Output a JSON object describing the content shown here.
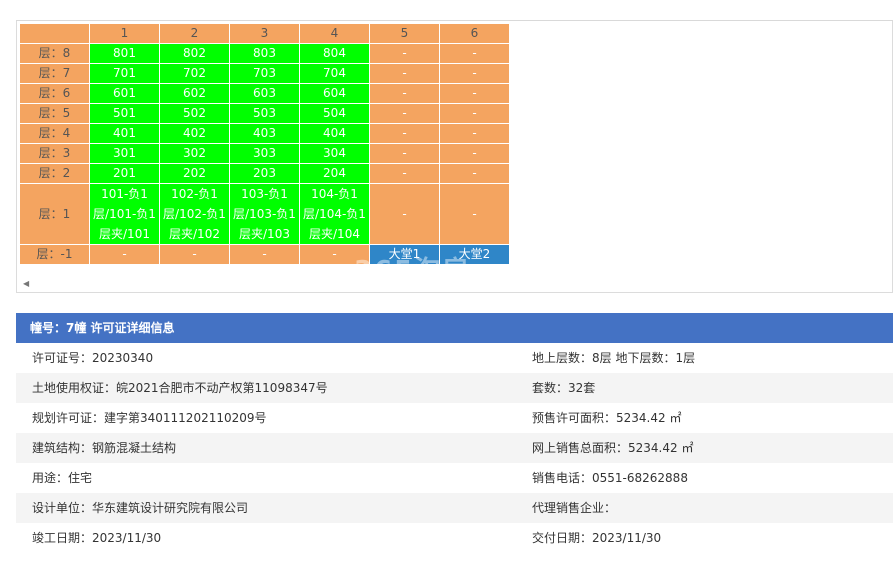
{
  "unit_grid": {
    "columns": [
      "1",
      "2",
      "3",
      "4",
      "5",
      "6"
    ],
    "rows": [
      {
        "floor": "层：8",
        "cells": [
          {
            "text": "801",
            "status": "green"
          },
          {
            "text": "802",
            "status": "green"
          },
          {
            "text": "803",
            "status": "green"
          },
          {
            "text": "804",
            "status": "green"
          },
          {
            "text": "-",
            "status": "orange"
          },
          {
            "text": "-",
            "status": "orange"
          }
        ]
      },
      {
        "floor": "层：7",
        "cells": [
          {
            "text": "701",
            "status": "green"
          },
          {
            "text": "702",
            "status": "green"
          },
          {
            "text": "703",
            "status": "green"
          },
          {
            "text": "704",
            "status": "green"
          },
          {
            "text": "-",
            "status": "orange"
          },
          {
            "text": "-",
            "status": "orange"
          }
        ]
      },
      {
        "floor": "层：6",
        "cells": [
          {
            "text": "601",
            "status": "green"
          },
          {
            "text": "602",
            "status": "green"
          },
          {
            "text": "603",
            "status": "green"
          },
          {
            "text": "604",
            "status": "green"
          },
          {
            "text": "-",
            "status": "orange"
          },
          {
            "text": "-",
            "status": "orange"
          }
        ]
      },
      {
        "floor": "层：5",
        "cells": [
          {
            "text": "501",
            "status": "green"
          },
          {
            "text": "502",
            "status": "green"
          },
          {
            "text": "503",
            "status": "green"
          },
          {
            "text": "504",
            "status": "green"
          },
          {
            "text": "-",
            "status": "orange"
          },
          {
            "text": "-",
            "status": "orange"
          }
        ]
      },
      {
        "floor": "层：4",
        "cells": [
          {
            "text": "401",
            "status": "green"
          },
          {
            "text": "402",
            "status": "green"
          },
          {
            "text": "403",
            "status": "green"
          },
          {
            "text": "404",
            "status": "green"
          },
          {
            "text": "-",
            "status": "orange"
          },
          {
            "text": "-",
            "status": "orange"
          }
        ]
      },
      {
        "floor": "层：3",
        "cells": [
          {
            "text": "301",
            "status": "green"
          },
          {
            "text": "302",
            "status": "green"
          },
          {
            "text": "303",
            "status": "green"
          },
          {
            "text": "304",
            "status": "green"
          },
          {
            "text": "-",
            "status": "orange"
          },
          {
            "text": "-",
            "status": "orange"
          }
        ]
      },
      {
        "floor": "层：2",
        "cells": [
          {
            "text": "201",
            "status": "green"
          },
          {
            "text": "202",
            "status": "green"
          },
          {
            "text": "203",
            "status": "green"
          },
          {
            "text": "204",
            "status": "green"
          },
          {
            "text": "-",
            "status": "orange"
          },
          {
            "text": "-",
            "status": "orange"
          }
        ]
      },
      {
        "floor": "层：1",
        "tall": true,
        "cells": [
          {
            "text": "101-负1层/101-负1层夹/101",
            "status": "green"
          },
          {
            "text": "102-负1层/102-负1层夹/102",
            "status": "green"
          },
          {
            "text": "103-负1层/103-负1层夹/103",
            "status": "green"
          },
          {
            "text": "104-负1层/104-负1层夹/104",
            "status": "green"
          },
          {
            "text": "-",
            "status": "orange"
          },
          {
            "text": "-",
            "status": "orange"
          }
        ]
      },
      {
        "floor": "层：-1",
        "cells": [
          {
            "text": "-",
            "status": "orange"
          },
          {
            "text": "-",
            "status": "orange"
          },
          {
            "text": "-",
            "status": "orange"
          },
          {
            "text": "-",
            "status": "orange"
          },
          {
            "text": "大堂1",
            "status": "blue"
          },
          {
            "text": "大堂2",
            "status": "blue"
          }
        ]
      }
    ]
  },
  "watermark": "365淘房",
  "details": {
    "header": "幢号：7幢 许可证详细信息",
    "rows": [
      {
        "left": "许可证号：20230340",
        "right": "地上层数：8层  地下层数：1层"
      },
      {
        "left": "土地使用权证：皖2021合肥市不动产权第11098347号",
        "right": "套数：32套"
      },
      {
        "left": "规划许可证：建字第340111202110209号",
        "right": "预售许可面积：5234.42 ㎡"
      },
      {
        "left": "建筑结构：钢筋混凝土结构",
        "right": "网上销售总面积：5234.42 ㎡"
      },
      {
        "left": "用途：住宅",
        "right": "销售电话：0551-68262888"
      },
      {
        "left": "设计单位：华东建筑设计研究院有限公司",
        "right": "代理销售企业："
      },
      {
        "left": "竣工日期：2023/11/30",
        "right": "交付日期：2023/11/30"
      }
    ]
  },
  "colors": {
    "available": "#00ff00",
    "unavailable": "#f4a460",
    "public": "#2f86c8",
    "header_bar": "#4472c4"
  }
}
